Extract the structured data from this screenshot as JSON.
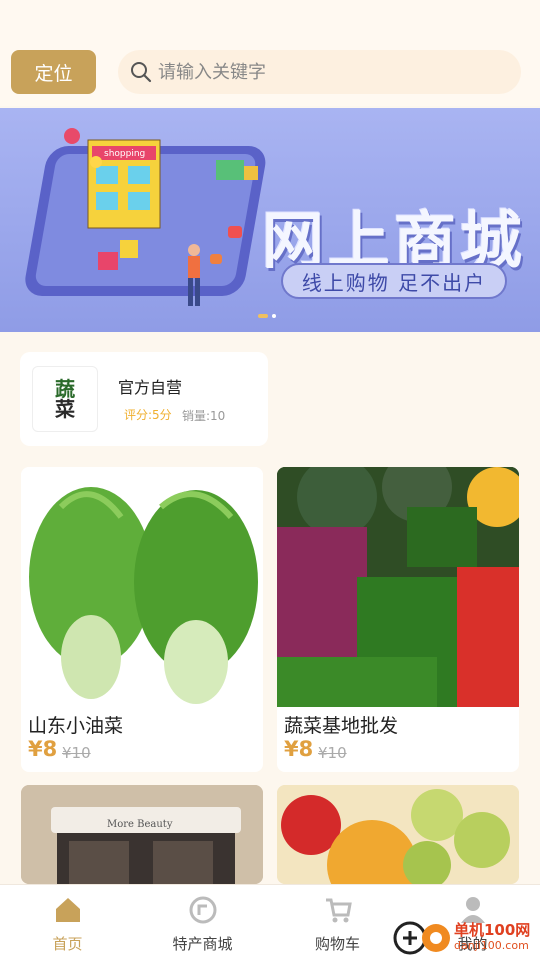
{
  "header": {
    "location_label": "定位",
    "search_placeholder": "请输入关键字"
  },
  "banner": {
    "title": "网上商城",
    "subtitle": "线上购物 足不出户",
    "badge_text": "shopping",
    "active_slide": 1,
    "slide_count": 2
  },
  "shop": {
    "logo_line1": "蔬",
    "logo_line2": "菜",
    "name": "官方自营",
    "score": "评分:5分",
    "sales": "销量:10"
  },
  "products": [
    {
      "name": "山东小油菜",
      "price": "¥8",
      "old_price": "¥10"
    },
    {
      "name": "蔬菜基地批发",
      "price": "¥8",
      "old_price": "¥10"
    },
    {
      "name": "",
      "price": "",
      "old_price": "",
      "store_sign": "More Beauty"
    },
    {
      "name": "",
      "price": "",
      "old_price": ""
    }
  ],
  "tabbar": {
    "items": [
      {
        "label": "首页",
        "icon": "home-icon",
        "active": true
      },
      {
        "label": "特产商城",
        "icon": "store-icon",
        "active": false
      },
      {
        "label": "购物车",
        "icon": "cart-icon",
        "active": false
      },
      {
        "label": "我的",
        "icon": "user-icon",
        "active": false
      }
    ]
  },
  "watermark": {
    "line1": "单机100网",
    "line2": "danji100.com"
  },
  "colors": {
    "accent": "#c8a25a",
    "price": "#e0a040",
    "banner": "#9aa6ec"
  }
}
